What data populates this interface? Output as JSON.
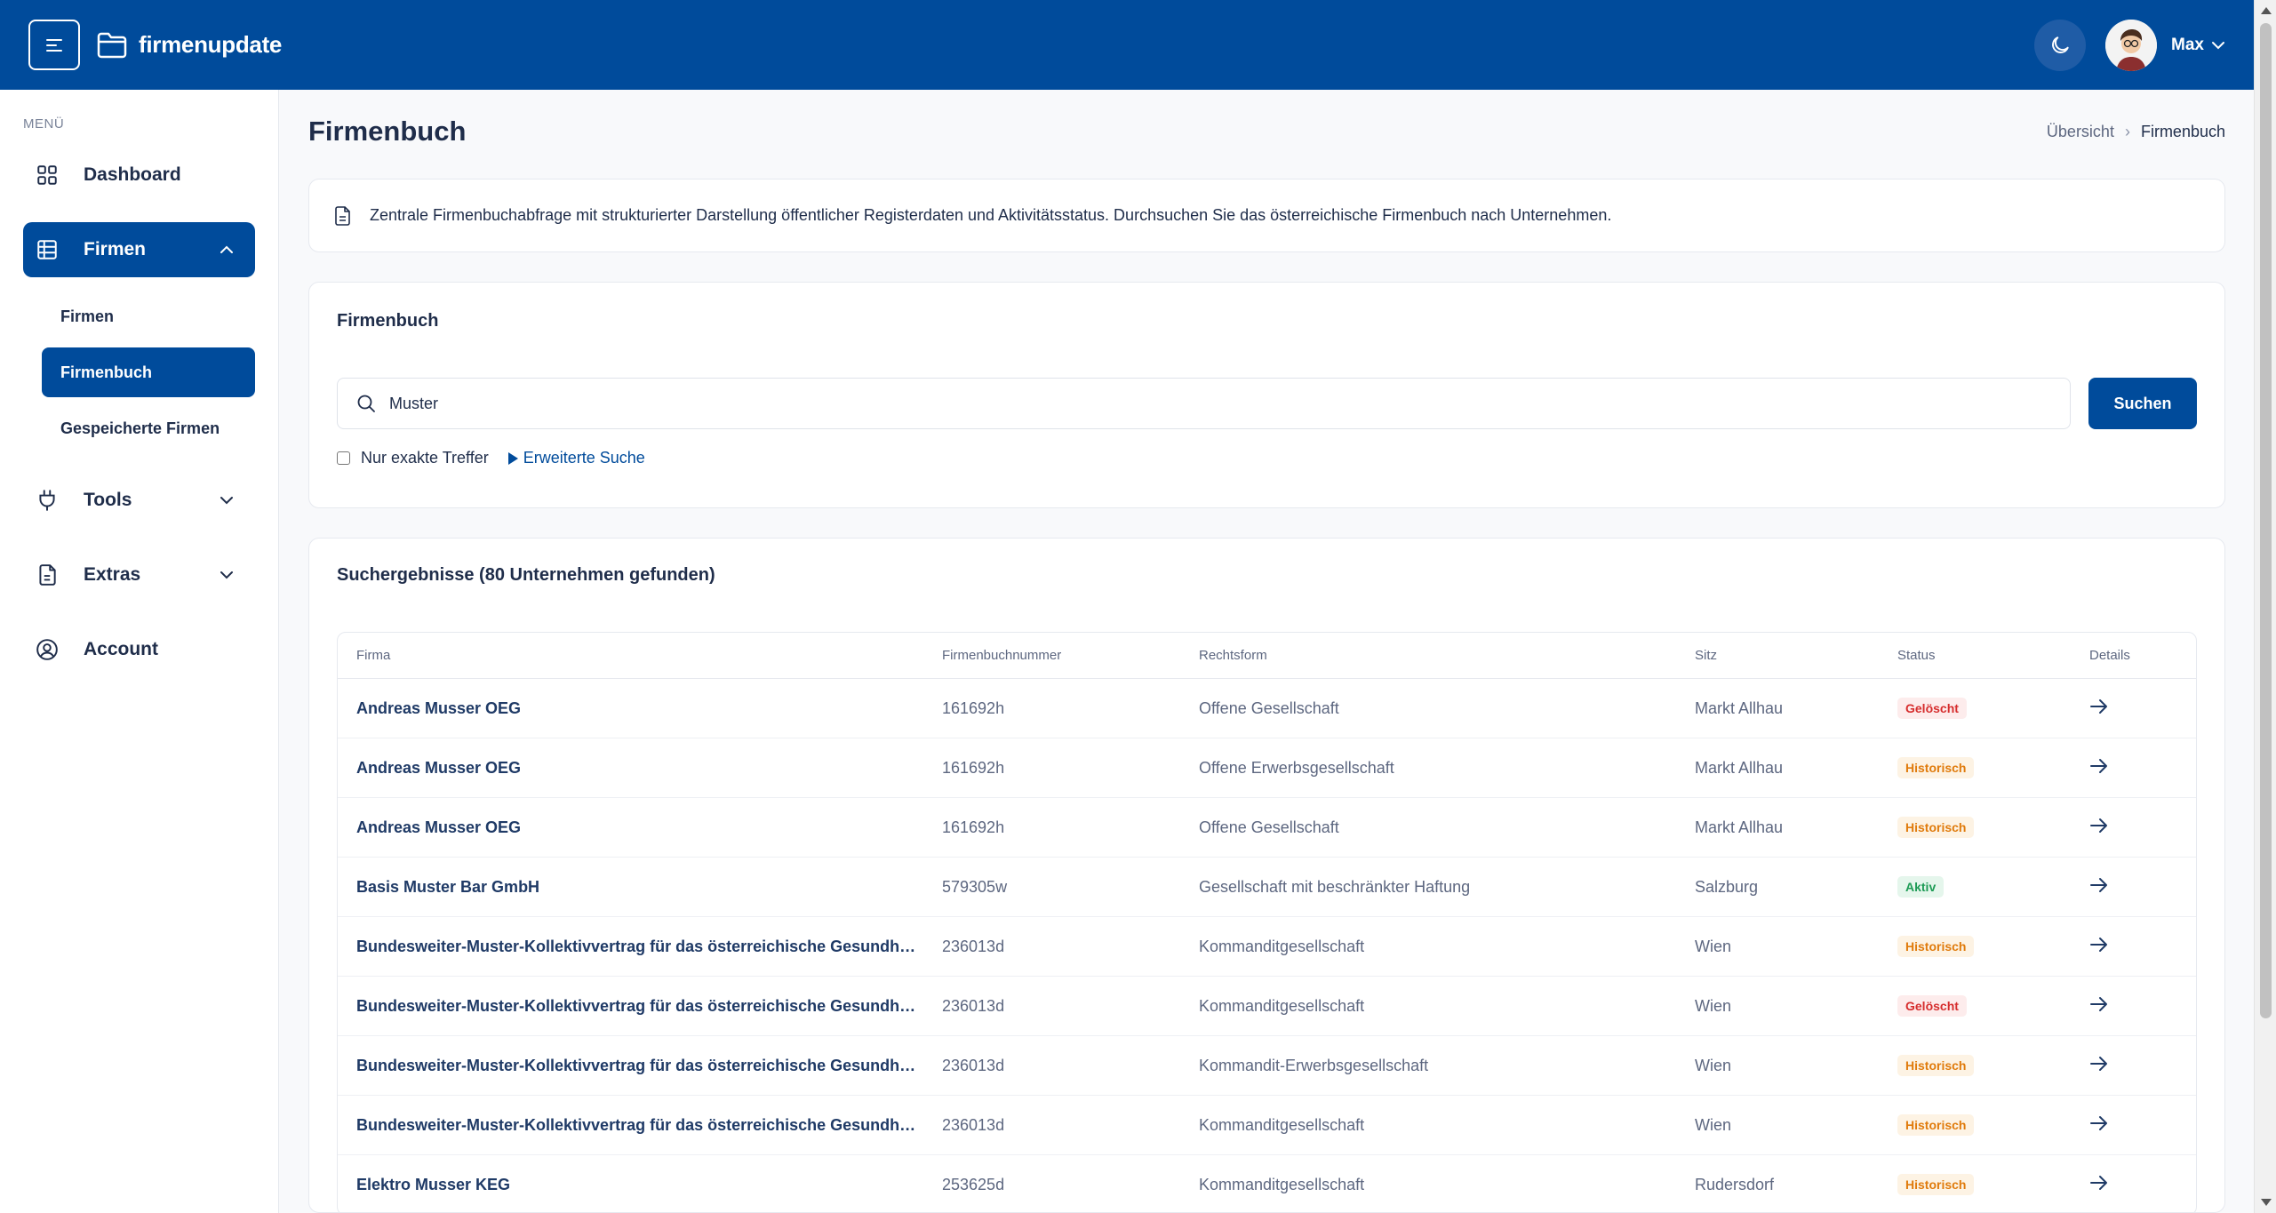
{
  "app": {
    "name": "firmenupdate",
    "user": "Max"
  },
  "sidebar": {
    "menu_label": "MENÜ",
    "dashboard": "Dashboard",
    "firmen": "Firmen",
    "sub": [
      "Firmen",
      "Firmenbuch",
      "Gespeicherte Firmen"
    ],
    "tools": "Tools",
    "extras": "Extras",
    "account": "Account"
  },
  "page": {
    "title": "Firmenbuch",
    "breadcrumb": [
      "Übersicht",
      "Firmenbuch"
    ],
    "info": "Zentrale Firmenbuchabfrage mit strukturierter Darstellung öffentlicher Registerdaten und Aktivitätsstatus. Durchsuchen Sie das österreichische Firmenbuch nach Unternehmen."
  },
  "search": {
    "title": "Firmenbuch",
    "value": "Muster",
    "button": "Suchen",
    "exact_label": "Nur exakte Treffer",
    "advanced_label": "Erweiterte Suche"
  },
  "results": {
    "title": "Suchergebnisse (80 Unternehmen gefunden)",
    "columns": [
      "Firma",
      "Firmenbuchnummer",
      "Rechtsform",
      "Sitz",
      "Status",
      "Details"
    ],
    "rows": [
      {
        "firma": "Andreas Musser OEG",
        "nummer": "161692h",
        "rechtsform": "Offene Gesellschaft",
        "sitz": "Markt Allhau",
        "status": "Gelöscht"
      },
      {
        "firma": "Andreas Musser OEG",
        "nummer": "161692h",
        "rechtsform": "Offene Erwerbsgesellschaft",
        "sitz": "Markt Allhau",
        "status": "Historisch"
      },
      {
        "firma": "Andreas Musser OEG",
        "nummer": "161692h",
        "rechtsform": "Offene Gesellschaft",
        "sitz": "Markt Allhau",
        "status": "Historisch"
      },
      {
        "firma": "Basis Muster Bar GmbH",
        "nummer": "579305w",
        "rechtsform": "Gesellschaft mit beschränkter Haftung",
        "sitz": "Salzburg",
        "status": "Aktiv"
      },
      {
        "firma": "Bundesweiter-Muster-Kollektivvertrag für das österreichische Gesundheit...",
        "nummer": "236013d",
        "rechtsform": "Kommanditgesellschaft",
        "sitz": "Wien",
        "status": "Historisch"
      },
      {
        "firma": "Bundesweiter-Muster-Kollektivvertrag für das österreichische Gesundheit...",
        "nummer": "236013d",
        "rechtsform": "Kommanditgesellschaft",
        "sitz": "Wien",
        "status": "Gelöscht"
      },
      {
        "firma": "Bundesweiter-Muster-Kollektivvertrag für das österreichische Gesundheit...",
        "nummer": "236013d",
        "rechtsform": "Kommandit-Erwerbsgesellschaft",
        "sitz": "Wien",
        "status": "Historisch"
      },
      {
        "firma": "Bundesweiter-Muster-Kollektivvertrag für das österreichische Gesundheit...",
        "nummer": "236013d",
        "rechtsform": "Kommanditgesellschaft",
        "sitz": "Wien",
        "status": "Historisch"
      },
      {
        "firma": "Elektro Musser KEG",
        "nummer": "253625d",
        "rechtsform": "Kommanditgesellschaft",
        "sitz": "Rudersdorf",
        "status": "Historisch"
      }
    ]
  },
  "colors": {
    "primary": "#004b9b",
    "geloescht": "#d62d2d",
    "historisch": "#e07b0c",
    "aktiv": "#1d9b55"
  }
}
